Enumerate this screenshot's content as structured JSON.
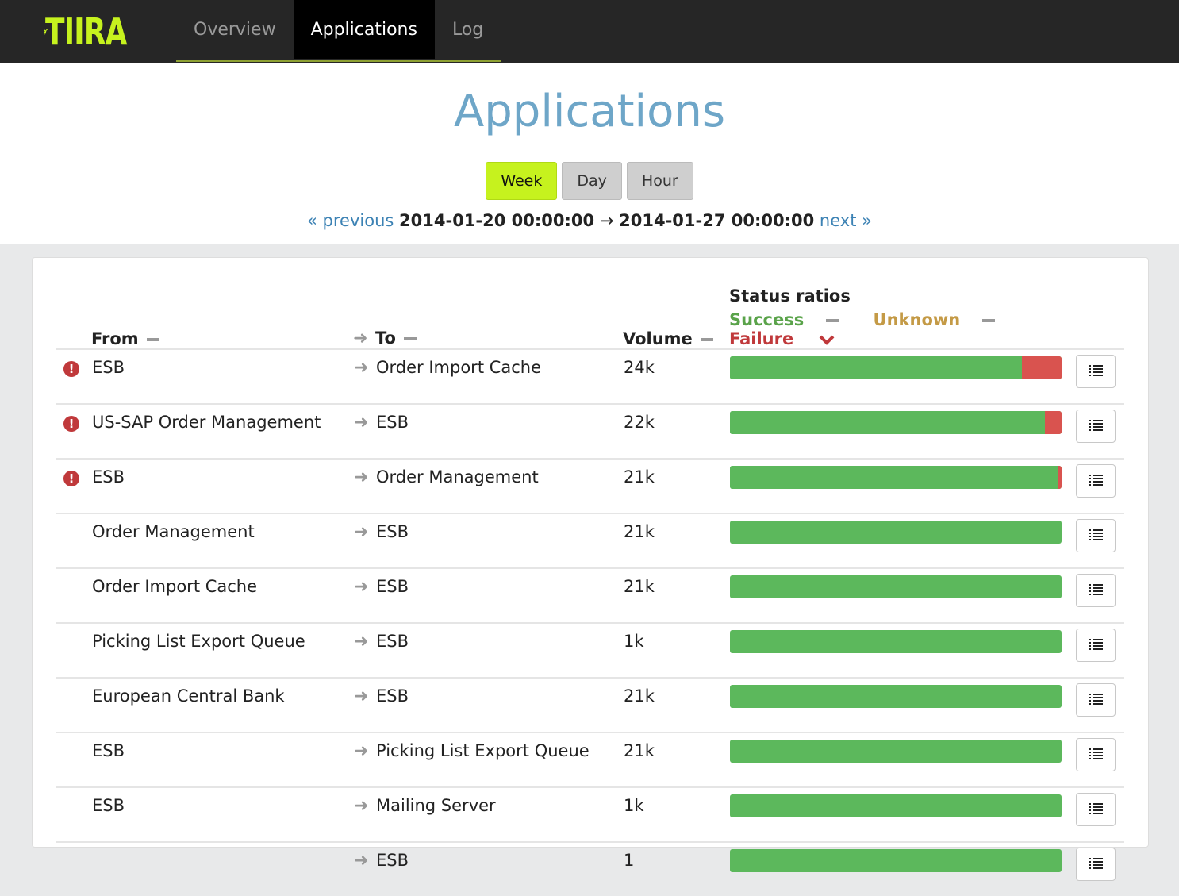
{
  "nav": {
    "logo_text": "TIIRA",
    "tabs": [
      {
        "label": "Overview",
        "active": false
      },
      {
        "label": "Applications",
        "active": true
      },
      {
        "label": "Log",
        "active": false
      }
    ]
  },
  "page": {
    "title": "Applications",
    "range_buttons": [
      {
        "label": "Week",
        "active": true
      },
      {
        "label": "Day",
        "active": false
      },
      {
        "label": "Hour",
        "active": false
      }
    ],
    "period": {
      "previous_label": "« previous",
      "start": "2014-01-20 00:00:00",
      "arrow": "→",
      "end": "2014-01-27 00:00:00",
      "next_label": "next »"
    }
  },
  "table": {
    "headers": {
      "from": "From",
      "to": "To",
      "volume": "Volume",
      "status_title": "Status ratios",
      "success": "Success",
      "unknown": "Unknown",
      "failure": "Failure"
    },
    "rows": [
      {
        "warning": true,
        "from": "ESB",
        "to": "Order Import Cache",
        "volume": "24k",
        "success": 0.88,
        "failure": 0.12
      },
      {
        "warning": true,
        "from": "US-SAP Order Management",
        "to": "ESB",
        "volume": "22k",
        "success": 0.95,
        "failure": 0.05
      },
      {
        "warning": true,
        "from": "ESB",
        "to": "Order Management",
        "volume": "21k",
        "success": 0.99,
        "failure": 0.01
      },
      {
        "warning": false,
        "from": "Order Management",
        "to": "ESB",
        "volume": "21k",
        "success": 1.0,
        "failure": 0.0
      },
      {
        "warning": false,
        "from": "Order Import Cache",
        "to": "ESB",
        "volume": "21k",
        "success": 1.0,
        "failure": 0.0
      },
      {
        "warning": false,
        "from": "Picking List Export Queue",
        "to": "ESB",
        "volume": "1k",
        "success": 1.0,
        "failure": 0.0
      },
      {
        "warning": false,
        "from": "European Central Bank",
        "to": "ESB",
        "volume": "21k",
        "success": 1.0,
        "failure": 0.0
      },
      {
        "warning": false,
        "from": "ESB",
        "to": "Picking List Export Queue",
        "volume": "21k",
        "success": 1.0,
        "failure": 0.0
      },
      {
        "warning": false,
        "from": "ESB",
        "to": "Mailing Server",
        "volume": "1k",
        "success": 1.0,
        "failure": 0.0
      },
      {
        "warning": false,
        "from": "",
        "to": "ESB",
        "volume": "1",
        "success": 1.0,
        "failure": 0.0
      }
    ]
  },
  "colors": {
    "brand": "#c6f21e",
    "title": "#6ea6c8",
    "success": "#5cb85c",
    "failure": "#d9534f",
    "unknown": "#c49a46",
    "link": "#3c82b4"
  },
  "icons": {
    "logo": "swallow-bird-icon",
    "warning": "exclamation-circle-icon",
    "arrow": "arrow-right-icon",
    "sort": "sort-dash-icon",
    "sort_active": "chevron-down-icon",
    "details": "list-icon"
  }
}
